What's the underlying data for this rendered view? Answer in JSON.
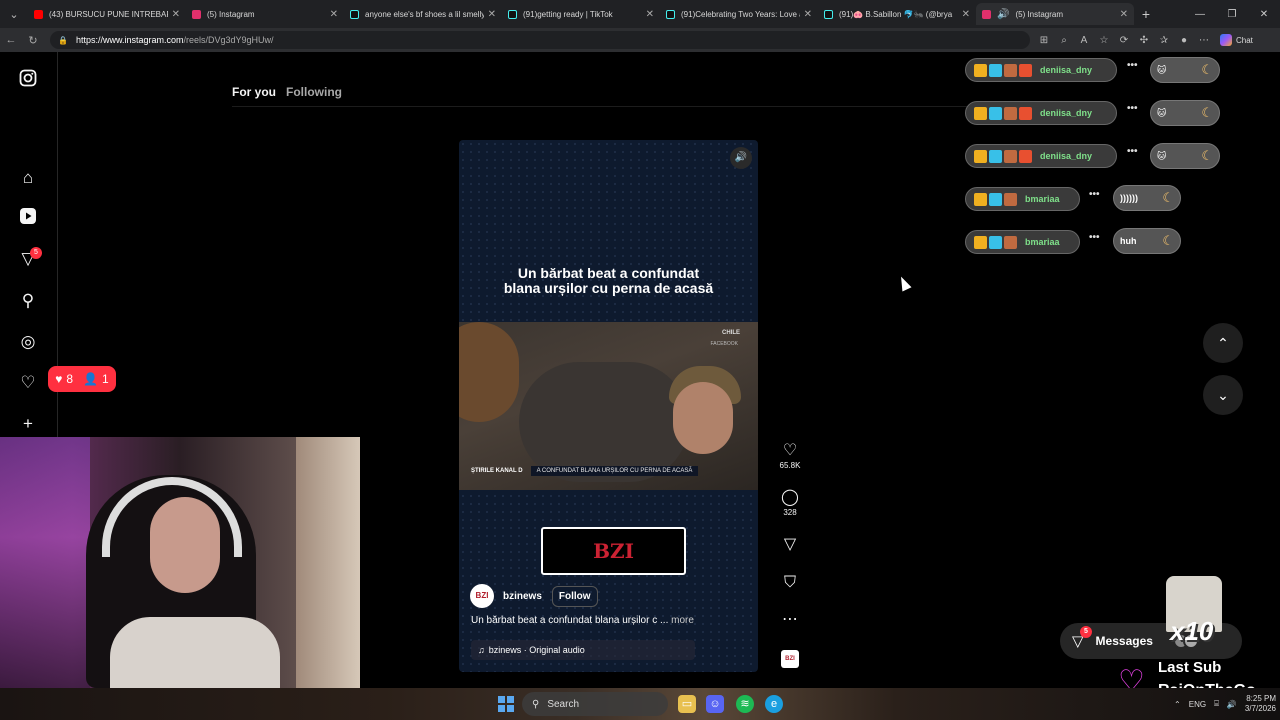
{
  "browser": {
    "tabs": [
      {
        "title": "(43) BURSUCU PUNE INTREBARI (",
        "color": "#ff0000"
      },
      {
        "title": "(5) Instagram",
        "color": "#e1306c"
      },
      {
        "title": "anyone else's bf shoes a lil smelly",
        "color": "#111111"
      },
      {
        "title": "(91)getting ready | TikTok",
        "color": "#111111"
      },
      {
        "title": "(91)Celebrating Two Years: Love a",
        "color": "#111111"
      },
      {
        "title": "(91)🐽 B.Sabillon 🐬🐜 (@brya",
        "color": "#111111"
      },
      {
        "title": "(5) Instagram",
        "color": "#e1306c"
      }
    ],
    "url_host": "https://www.instagram.com",
    "url_path": "/reels/DVg3dY9gHUw/",
    "chat_label": "Chat"
  },
  "sidebar": {
    "notification_badge": "5",
    "likes_count": "8",
    "followers_count": "1"
  },
  "feed": {
    "tab_for_you": "For you",
    "tab_following": "Following"
  },
  "reel": {
    "headline_line1": "Un bărbat beat a confundat",
    "headline_line2": "blana urșilor cu perna de acasă",
    "video_watermark": "CHILE",
    "video_watermark_sub": "FACEBOOK",
    "lower_third_brand": "ȘTIRILE KANAL D",
    "lower_third_text": "A CONFUNDAT BLANA URȘILOR CU PERNA DE ACASĂ",
    "logo_text": "BZI",
    "username": "bzinews",
    "follow_label": "Follow",
    "caption": "Un bărbat beat a confundat blana urșilor c ...",
    "caption_more": "more",
    "audio": "bzinews · Original audio",
    "likes": "65.8K",
    "comments": "328"
  },
  "overlay_chat": [
    {
      "user": "deniisa_dny",
      "msg": "🐱"
    },
    {
      "user": "deniisa_dny",
      "msg": "🐱"
    },
    {
      "user": "deniisa_dny",
      "msg": "🐱"
    },
    {
      "user": "bmariaa",
      "msg": "))))))"
    },
    {
      "user": "bmariaa",
      "msg": "huh"
    }
  ],
  "messages": {
    "label": "Messages",
    "badge": "5"
  },
  "stream_overlay": {
    "multiplier": "x10",
    "last_sub_title": "Last Sub",
    "last_sub_name": "RaiOnTheGo"
  },
  "taskbar": {
    "search_label": "Search",
    "language": "ENG",
    "time": "8:25 PM",
    "date": "3/7/2026"
  }
}
